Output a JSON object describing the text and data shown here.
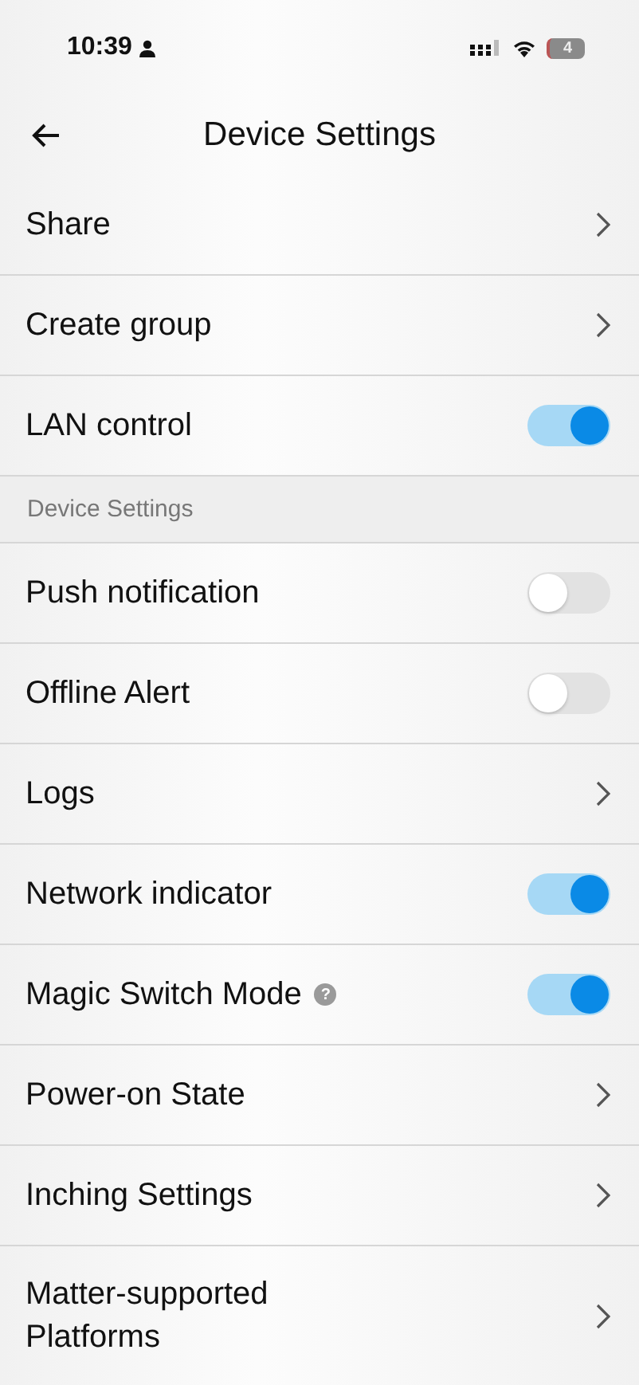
{
  "status_bar": {
    "time": "10:39",
    "battery": "4"
  },
  "header": {
    "title": "Device Settings"
  },
  "items": [
    {
      "kind": "link",
      "label": "Share"
    },
    {
      "kind": "link",
      "label": "Create group"
    },
    {
      "kind": "toggle",
      "label": "LAN control",
      "on": true
    },
    {
      "kind": "section",
      "label": "Device Settings"
    },
    {
      "kind": "toggle",
      "label": "Push notification",
      "on": false
    },
    {
      "kind": "toggle",
      "label": "Offline Alert",
      "on": false
    },
    {
      "kind": "link",
      "label": "Logs"
    },
    {
      "kind": "toggle",
      "label": "Network indicator",
      "on": true
    },
    {
      "kind": "toggle",
      "label": "Magic Switch Mode",
      "on": true,
      "hint": "?"
    },
    {
      "kind": "link",
      "label": "Power-on State"
    },
    {
      "kind": "link",
      "label": "Inching Settings"
    },
    {
      "kind": "link",
      "label": "Matter-supported Platforms"
    }
  ]
}
